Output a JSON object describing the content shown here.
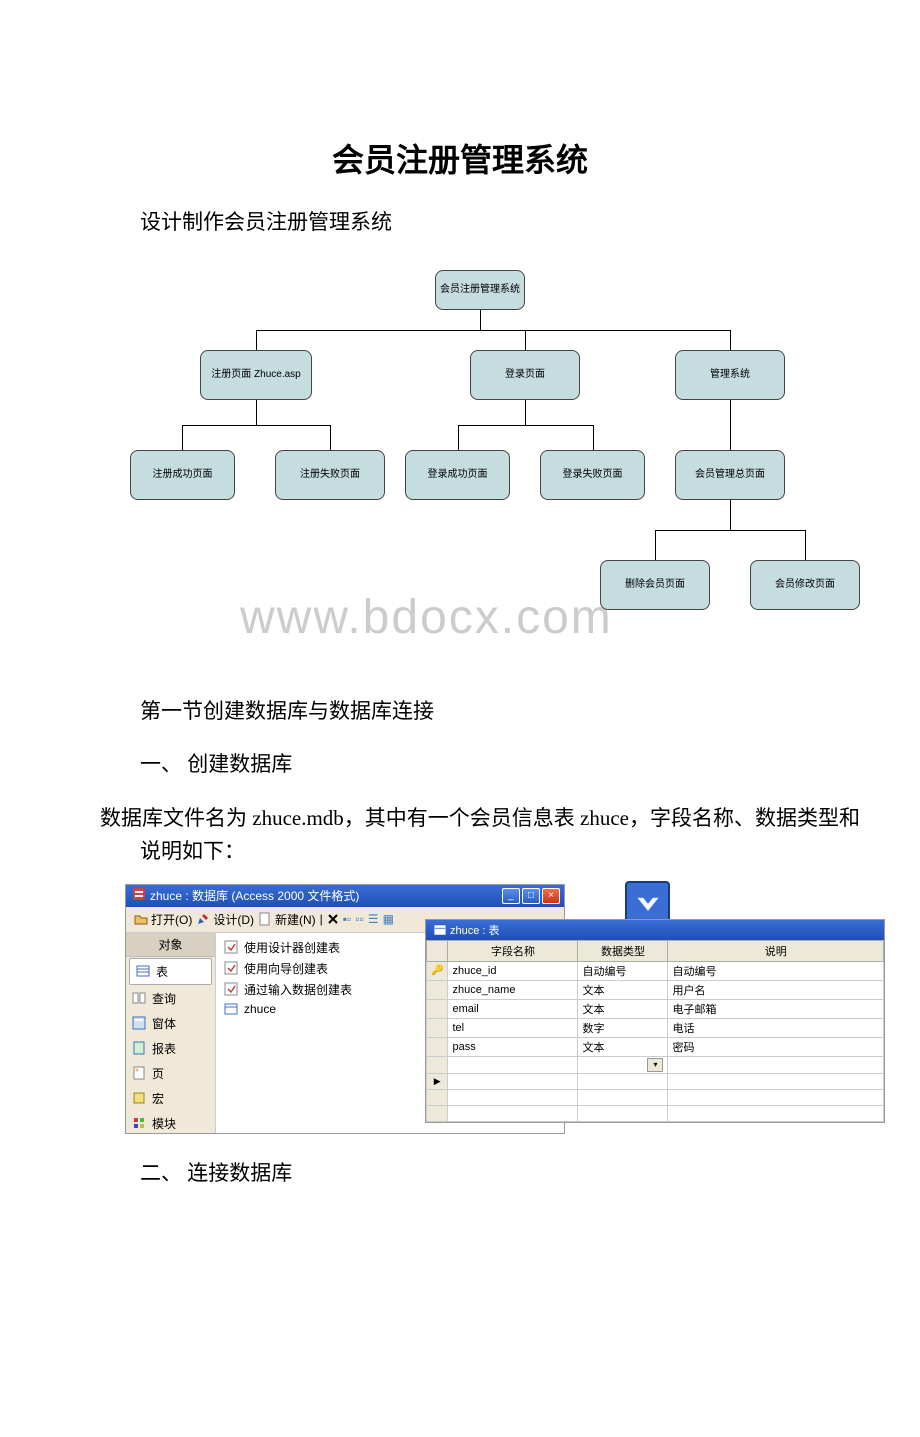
{
  "title": "会员注册管理系统",
  "intro": "设计制作会员注册管理系统",
  "watermark": "www.bdocx.com",
  "diagram": {
    "root": "会员注册管理系统",
    "l1": {
      "a": "注册页面 Zhuce.asp",
      "b": "登录页面",
      "c": "管理系统"
    },
    "l2": {
      "a1": "注册成功页面",
      "a2": "注册失败页面",
      "b1": "登录成功页面",
      "b2": "登录失败页面",
      "c1": "会员管理总页面"
    },
    "l3": {
      "c1a": "删除会员页面",
      "c1b": "会员修改页面"
    }
  },
  "section1_title": "第一节创建数据库与数据库连接",
  "section1_1": "一、 创建数据库",
  "section1_1_body": "数据库文件名为 zhuce.mdb，其中有一个会员信息表 zhuce，字段名称、数据类型和说明如下：",
  "section1_2": "二、 连接数据库",
  "db_window": {
    "title": "zhuce : 数据库 (Access 2000 文件格式)",
    "toolbar": {
      "open": "打开(O)",
      "design": "设计(D)",
      "new": "新建(N)"
    },
    "side_header": "对象",
    "side_items": [
      "表",
      "查询",
      "窗体",
      "报表",
      "页",
      "宏",
      "模块"
    ],
    "list_items": [
      "使用设计器创建表",
      "使用向导创建表",
      "通过输入数据创建表",
      "zhuce"
    ]
  },
  "chart_data": {
    "type": "table",
    "title": "zhuce : 表",
    "columns": [
      "字段名称",
      "数据类型",
      "说明"
    ],
    "rows": [
      [
        "zhuce_id",
        "自动编号",
        "自动编号"
      ],
      [
        "zhuce_name",
        "文本",
        "用户名"
      ],
      [
        "email",
        "文本",
        "电子邮箱"
      ],
      [
        "tel",
        "数字",
        "电话"
      ],
      [
        "pass",
        "文本",
        "密码"
      ]
    ]
  }
}
